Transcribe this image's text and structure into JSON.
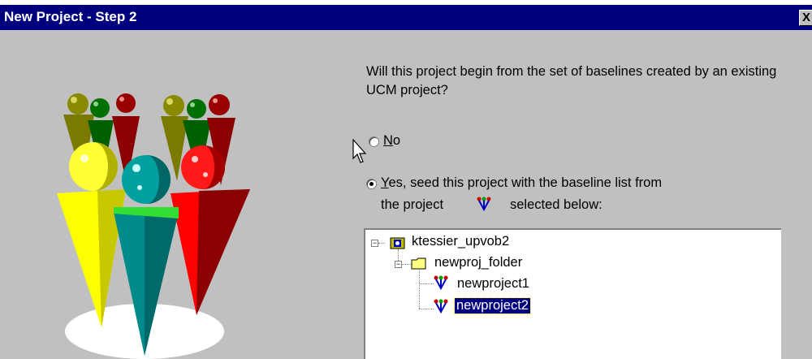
{
  "window": {
    "title": "New Project - Step 2",
    "close_label": "X"
  },
  "question": {
    "text": "Will this project begin from the set of baselines created by an existing UCM project?"
  },
  "options": {
    "no": {
      "label_underlined": "N",
      "label_rest": "o",
      "checked": false
    },
    "yes": {
      "label_underlined": "Y",
      "label_rest": "es, seed this project with the baseline list from",
      "line2_before": "the project",
      "line2_after": "selected below:",
      "checked": true
    }
  },
  "tree": {
    "items": [
      {
        "label": "ktessier_upvob2",
        "icon": "vob-icon",
        "expander": "−"
      },
      {
        "label": "newproj_folder",
        "icon": "folder-icon",
        "expander": "−"
      },
      {
        "label": "newproject1",
        "icon": "project-icon"
      },
      {
        "label": "newproject2",
        "icon": "project-icon",
        "selected": true
      }
    ]
  },
  "colors": {
    "title_bar": "#00007f",
    "dialog_bg": "#c0c0c0",
    "selection": "#00007f"
  }
}
